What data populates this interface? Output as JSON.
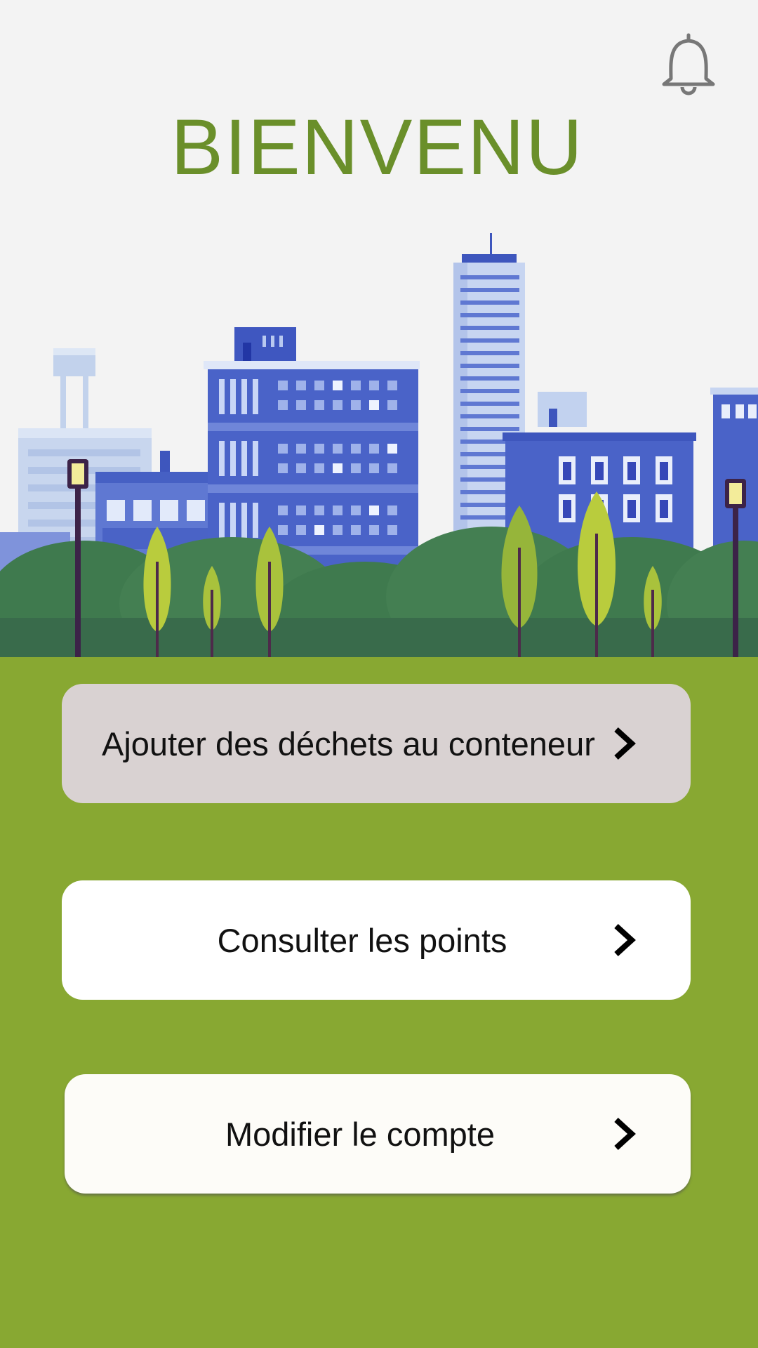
{
  "header": {
    "title": "BIENVENU",
    "notification_icon": "bell-icon"
  },
  "colors": {
    "title": "#6a8f2a",
    "background": "#f3f3f3",
    "lawn": "#88a832",
    "selected_button": "#d9d2d2",
    "button": "#ffffff"
  },
  "menu": {
    "items": [
      {
        "label": "Ajouter des déchets au conteneur",
        "icon": "chevron-right-icon",
        "state": "pressed"
      },
      {
        "label": "Consulter les points",
        "icon": "chevron-right-icon"
      },
      {
        "label": "Modifier le compte",
        "icon": "chevron-right-icon"
      }
    ]
  }
}
